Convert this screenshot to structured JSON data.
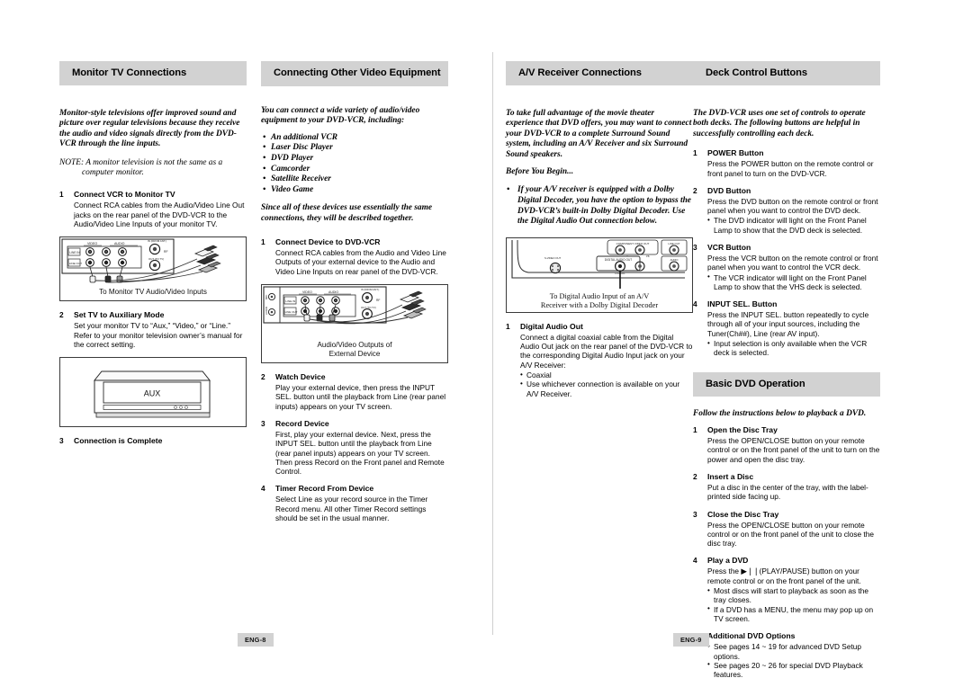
{
  "document": {
    "type": "dvd-vcr-user-manual-spread",
    "header_bg": "#d2d2d2",
    "text_color": "#000000"
  },
  "left_page": {
    "footer_label": "ENG-8",
    "columns": [
      {
        "heading": "Monitor TV Connections",
        "intro": [
          "Monitor-style televisions offer improved sound and picture over regular televisions because they receive the audio and video signals directly from the DVD-VCR through the line inputs."
        ],
        "note": "NOTE: A monitor television is not the same as a computer monitor.",
        "steps": [
          {
            "num": "1",
            "title": "Connect VCR to Monitor TV",
            "body": "Connect RCA cables from the Audio/Video Line Out jacks on the rear panel of the DVD-VCR to the Audio/Video Line Inputs of your monitor TV."
          },
          {
            "num": "2",
            "title": "Set TV to Auxiliary Mode",
            "body": "Set your monitor TV to “Aux,” “Video,” or “Line.” Refer to your monitor television owner’s manual for the correct setting."
          },
          {
            "num": "3",
            "title": "Connection is Complete",
            "body": ""
          }
        ],
        "figures": {
          "rear_panel_caption": "To Monitor TV Audio/Video Inputs",
          "rear_panel_labels": {
            "video": "VIDEO",
            "audio": "AUDIO",
            "line_in": "LINE IN",
            "line_out": "LINE OUT",
            "antenna": "IN (FROM ANT.)",
            "out_to_tv": "OUT (TO TV)",
            "rf": "RF"
          },
          "tv_screen_text": "AUX"
        }
      },
      {
        "heading": "Connecting Other Video Equipment",
        "intro": [
          "You can connect a wide variety of audio/video equipment to your DVD-VCR, including:"
        ],
        "device_list": [
          "An additional VCR",
          "Laser Disc Player",
          "DVD Player",
          "Camcorder",
          "Satellite Receiver",
          "Video Game"
        ],
        "intro_after": "Since all of these devices use essentially the same connections, they will be described together.",
        "steps": [
          {
            "num": "1",
            "title": "Connect Device to DVD-VCR",
            "body": "Connect RCA cables from the Audio and Video Line Outputs of your external device to the Audio and Video Line Inputs on rear panel of the DVD-VCR."
          },
          {
            "num": "2",
            "title": "Watch Device",
            "body": "Play your external device, then press the INPUT SEL. button until the playback from Line (rear panel inputs) appears on your TV screen."
          },
          {
            "num": "3",
            "title": "Record Device",
            "body": "First, play your external device. Next, press the INPUT SEL. button until the playback from Line (rear panel inputs) appears on your TV screen. Then press Record on the Front panel and Remote Control."
          },
          {
            "num": "4",
            "title": "Timer Record From Device",
            "body": "Select Line as your record source in the Timer Record menu. All other Timer Record settings should be set in the usual manner."
          }
        ],
        "figures": {
          "rear_panel_caption_line1": "Audio/Video Outputs of",
          "rear_panel_caption_line2": "External Device",
          "rear_panel_labels": {
            "video": "VIDEO",
            "audio": "AUDIO",
            "line_in": "LINE IN",
            "line_out": "LINE OUT",
            "antenna": "IN (FROM ANT.)",
            "out_to_tv": "OUT (TO TV)",
            "rf": "RF",
            "mic": "MIC",
            "audio_side": "AUDIO"
          }
        }
      }
    ]
  },
  "right_page": {
    "footer_label": "ENG-9",
    "columns": [
      {
        "heading": "A/V Receiver Connections",
        "intro": [
          "To take full advantage of the movie theater experience that DVD offers, you may want to connect your DVD-VCR to a complete Surround Sound system, including an A/V Receiver and six Surround Sound speakers.",
          "Before You Begin..."
        ],
        "bullet_ital": "If your A/V receiver is equipped with a Dolby Digital Decoder, you have the option to bypass the DVD-VCR’s built-in Dolby Digital Decoder. Use the Digital Audio Out connection below.",
        "steps": [
          {
            "num": "1",
            "title": "Digital Audio Out",
            "body": "Connect a digital coaxial cable from the Digital Audio Out jack on the rear panel of the DVD-VCR to the corresponding Digital Audio Input jack on your A/V Receiver:",
            "sub": [
              "Coaxial",
              "Use whichever connection is available on your A/V Receiver."
            ]
          }
        ],
        "figures": {
          "caption_line1": "To Digital Audio Input of an A/V",
          "caption_line2": "Receiver with a Dolby Digital Decoder",
          "labels": {
            "component": "COMPONENT VIDEO OUT",
            "digital_audio_out": "DIGITAL AUDIO OUT",
            "svideo": "S-VIDEO OUT",
            "line_out": "LINE OUT",
            "audio": "AUDIO",
            "coaxial": "COAXIAL"
          }
        }
      },
      {
        "heading": "Deck Control Buttons",
        "intro": [
          "The DVD-VCR uses one set of controls to operate both decks. The following buttons are helpful in successfully controlling each deck."
        ],
        "steps": [
          {
            "num": "1",
            "title": "POWER Button",
            "body": "Press the POWER button on the remote control or front panel to turn on the DVD-VCR."
          },
          {
            "num": "2",
            "title": "DVD Button",
            "body": "Press the DVD button on the remote control or front panel when you want to control the DVD deck.",
            "sub": [
              "The DVD indicator will light on the Front Panel Lamp to show that the DVD deck is selected."
            ]
          },
          {
            "num": "3",
            "title": "VCR Button",
            "body": "Press the VCR button on the remote control or front panel when you want to control the VCR deck.",
            "sub": [
              "The VCR indicator will light on the Front Panel Lamp to show that the VHS deck is selected."
            ]
          },
          {
            "num": "4",
            "title": "INPUT SEL. Button",
            "body": "Press the INPUT SEL. button repeatedly to cycle through all of your input sources, including the Tuner(Ch##), Line (rear AV input).",
            "sub": [
              "Input selection is only available when the VCR deck is selected."
            ]
          }
        ]
      },
      {
        "heading": "Basic DVD Operation",
        "intro": [
          "Follow the instructions below to playback a DVD."
        ],
        "steps": [
          {
            "num": "1",
            "title": "Open the Disc Tray",
            "body": "Press the OPEN/CLOSE button on your remote control or on the front panel of the unit to turn on the power and open the disc tray."
          },
          {
            "num": "2",
            "title": "Insert a Disc",
            "body": "Put a disc in the center of the tray, with the label-printed side facing up."
          },
          {
            "num": "3",
            "title": "Close the Disc Tray",
            "body": "Press the OPEN/CLOSE button on your remote control or on the front panel of the unit to close the disc tray."
          },
          {
            "num": "4",
            "title": "Play a DVD",
            "body": "Press the ▶❘❘(PLAY/PAUSE) button on your remote control or on the front panel of the unit.",
            "sub": [
              "Most discs will start to playback as soon as the tray closes.",
              "If a DVD has a MENU, the menu may pop up on TV screen."
            ]
          },
          {
            "num": "5",
            "title": "Additional DVD Options",
            "body": "",
            "sub": [
              "See pages 14 ~ 19 for advanced DVD Setup options.",
              "See pages 20 ~ 26 for special DVD Playback features."
            ]
          }
        ]
      }
    ]
  }
}
